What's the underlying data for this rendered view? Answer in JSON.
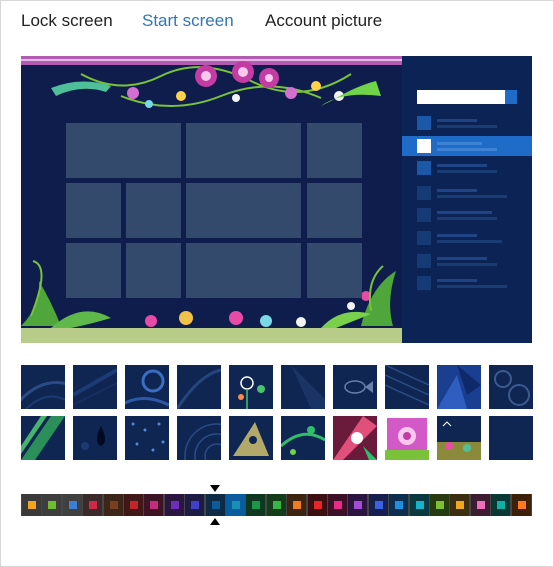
{
  "tabs": {
    "lock_screen": "Lock screen",
    "start_screen": "Start screen",
    "account_picture": "Account picture",
    "active": "start_screen"
  },
  "preview": {
    "background_color": "#0e1d4b",
    "tile_color": "#344a6c",
    "right_pane_color": "#0c2356",
    "highlight_color": "#1e6cc8"
  },
  "background_patterns": {
    "row1": [
      "swirl-dark",
      "ribbon-dark",
      "swirl-blue",
      "arc-dark",
      "dandelion-teal",
      "wave-dark",
      "fish-dark",
      "lines-dark",
      "shards-blue",
      "gears-dark"
    ],
    "row2": [
      "stripes-green",
      "drops-dark",
      "dots-dark",
      "rings-dark",
      "bird-olive",
      "vines-green",
      "flower-pink",
      "flower-magenta",
      "dinos-olive",
      "plain-dark"
    ],
    "selected_index": 17
  },
  "color_swatches": [
    "#f2a41e",
    "#6dbd2f",
    "#3a7fd4",
    "#d1284a",
    "#7a3e20",
    "#c3262a",
    "#c72b7e",
    "#6d2eb8",
    "#4240c8",
    "#0a5d9c",
    "#1a8fb5",
    "#18974a",
    "#38b548",
    "#f07d1c",
    "#e8262a",
    "#ea2a86",
    "#a24bd4",
    "#3a62e0",
    "#1f8fe0",
    "#12b5c8",
    "#7cbf2f",
    "#f0a81c",
    "#ee6fb8",
    "#11b0a4",
    "#ff7a1a"
  ],
  "selected_swatch_index": 10
}
